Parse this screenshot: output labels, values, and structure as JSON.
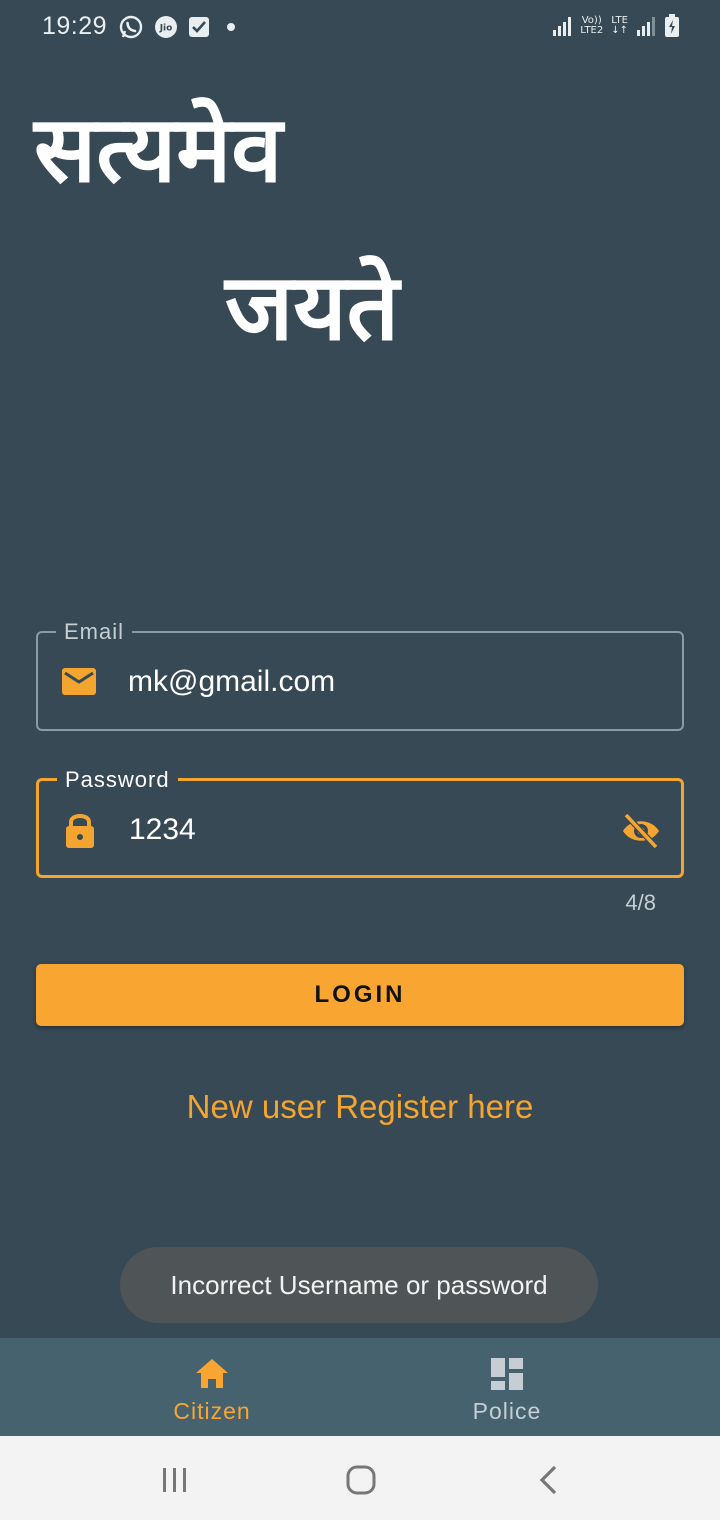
{
  "status_bar": {
    "time": "19:29",
    "left_icons": [
      "whatsapp-icon",
      "jio-icon",
      "task-check-icon",
      "dot-icon"
    ],
    "right_labels": {
      "volte_top": "Vo))",
      "volte_bottom": "LTE2",
      "lte": "LTE"
    },
    "right_icons": [
      "signal-icon",
      "volte-icon",
      "data-arrows-icon",
      "signal-2-icon",
      "battery-charging-icon"
    ]
  },
  "hero": {
    "line1": "सत्यमेव",
    "line2": "जयते"
  },
  "login_form": {
    "email": {
      "label": "Email",
      "value": "mk@gmail.com",
      "icon": "mail-icon"
    },
    "password": {
      "label": "Password",
      "value": "1234",
      "icon": "lock-icon",
      "trailing_icon": "eye-off-icon",
      "counter": "4/8"
    },
    "login_label": "LOGIN",
    "register_label": "New user Register here"
  },
  "toast": {
    "message": "Incorrect Username or password"
  },
  "bottom_nav": {
    "items": [
      {
        "label": "Citizen",
        "icon": "home-icon",
        "active": true
      },
      {
        "label": "Police",
        "icon": "dashboard-icon",
        "active": false
      }
    ]
  },
  "colors": {
    "background": "#374955",
    "accent": "#f8a631",
    "nav_background": "#46626e",
    "toast_background": "#4f5456",
    "inactive_nav": "#c6ced3"
  }
}
